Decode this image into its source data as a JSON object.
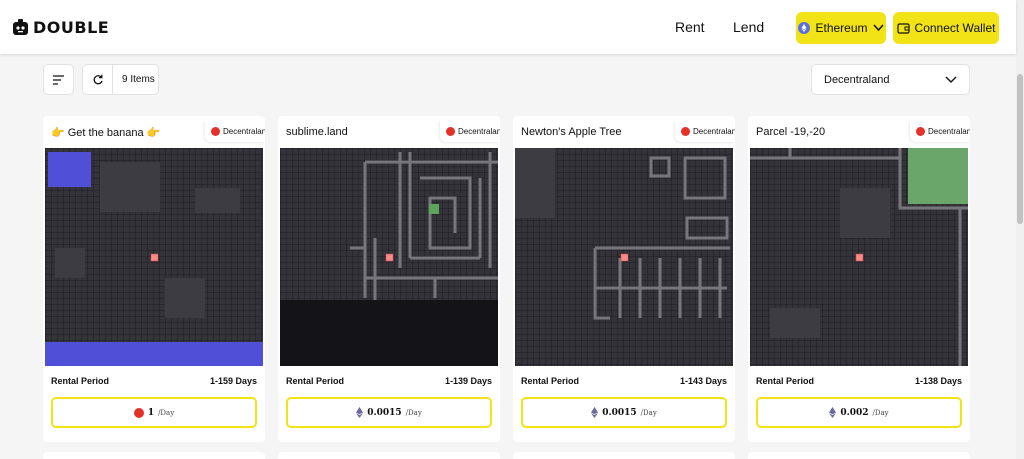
{
  "header": {
    "logo_text": "DOUBLE",
    "nav": {
      "rent": "Rent",
      "lend": "Lend"
    },
    "network_button": "Ethereum",
    "connect_button": "Connect Wallet"
  },
  "toolbar": {
    "items_count": "9 Items",
    "collection_selected": "Decentraland"
  },
  "cards": [
    {
      "title": "👉 Get the banana 👉",
      "badge": "Decentraland",
      "period_label": "Rental Period",
      "period_value": "1-159 Days",
      "price": "1",
      "price_unit": "/Day",
      "currency_icon": "mana-icon"
    },
    {
      "title": "sublime.land",
      "badge": "Decentraland",
      "period_label": "Rental Period",
      "period_value": "1-139 Days",
      "price": "0.0015",
      "price_unit": "/Day",
      "currency_icon": "eth-icon"
    },
    {
      "title": "Newton's Apple Tree",
      "badge": "Decentraland",
      "period_label": "Rental Period",
      "period_value": "1-143 Days",
      "price": "0.0015",
      "price_unit": "/Day",
      "currency_icon": "eth-icon"
    },
    {
      "title": "Parcel -19,-20",
      "badge": "Decentraland",
      "period_label": "Rental Period",
      "period_value": "1-138 Days",
      "price": "0.002",
      "price_unit": "/Day",
      "currency_icon": "eth-icon"
    }
  ],
  "colors": {
    "accent": "#f2e317",
    "map_bg": "#2b2a30",
    "mana": "#e4312a",
    "marker": "#ff8a8a"
  }
}
